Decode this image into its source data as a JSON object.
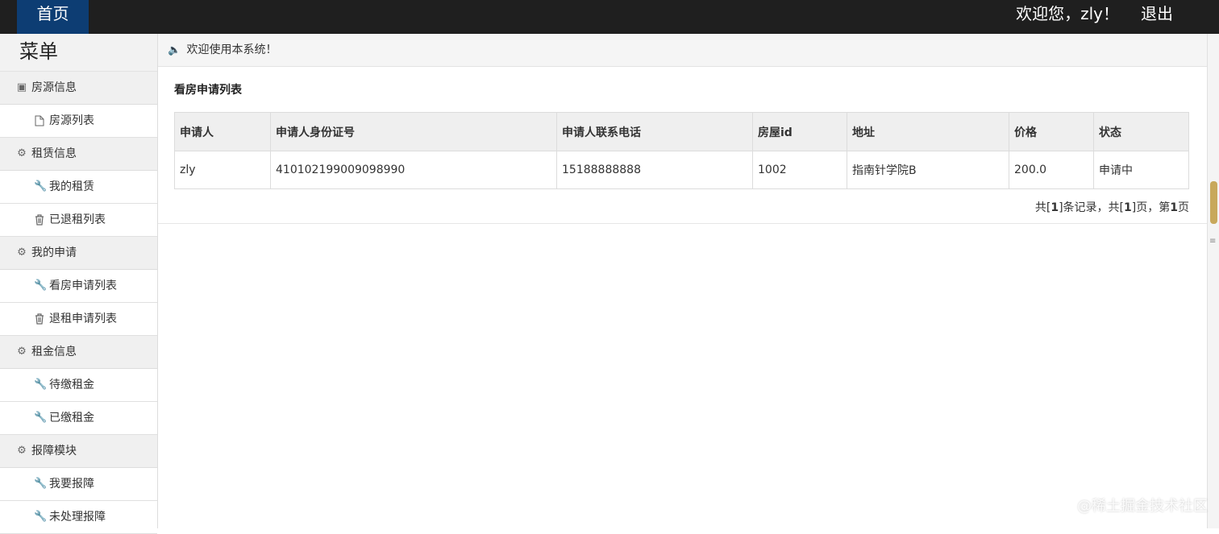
{
  "topbar": {
    "home_label": "首页",
    "welcome_text": "欢迎您，zly！",
    "logout_label": "退出"
  },
  "sidebar": {
    "title": "菜单",
    "groups": [
      {
        "label": "房源信息",
        "icon": "building-icon",
        "items": [
          {
            "label": "房源列表",
            "icon": "file-icon"
          }
        ]
      },
      {
        "label": "租赁信息",
        "icon": "gear-icon",
        "items": [
          {
            "label": "我的租赁",
            "icon": "wrench-icon"
          },
          {
            "label": "已退租列表",
            "icon": "trash-icon"
          }
        ]
      },
      {
        "label": "我的申请",
        "icon": "gear-icon",
        "items": [
          {
            "label": "看房申请列表",
            "icon": "wrench-icon"
          },
          {
            "label": "退租申请列表",
            "icon": "trash-icon"
          }
        ]
      },
      {
        "label": "租金信息",
        "icon": "gear-icon",
        "items": [
          {
            "label": "待缴租金",
            "icon": "wrench-icon"
          },
          {
            "label": "已缴租金",
            "icon": "wrench-icon"
          }
        ]
      },
      {
        "label": "报障模块",
        "icon": "gear-icon",
        "items": [
          {
            "label": "我要报障",
            "icon": "wrench-icon"
          },
          {
            "label": "未处理报障",
            "icon": "wrench-icon"
          }
        ]
      }
    ]
  },
  "notice": {
    "icon": "speaker-icon",
    "text": "欢迎使用本系统！"
  },
  "main": {
    "section_title": "看房申请列表",
    "table": {
      "headers": [
        "申请人",
        "申请人身份证号",
        "申请人联系电话",
        "房屋id",
        "地址",
        "价格",
        "状态"
      ],
      "rows": [
        [
          "zly",
          "410102199009098990",
          "15188888888",
          "1002",
          "指南针学院B",
          "200.0",
          "申请中"
        ]
      ]
    },
    "pager": {
      "prefix": "共[",
      "total_records": "1",
      "mid": "]条记录，共[",
      "total_pages": "1",
      "mid2": "]页，第",
      "current_page": "1",
      "suffix": "页"
    }
  },
  "watermark": "@稀土掘金技术社区",
  "colors": {
    "topbar_bg": "#1f1f1f",
    "home_tab_bg": "#0d3d73",
    "scroll_thumb": "#c8a85b"
  }
}
